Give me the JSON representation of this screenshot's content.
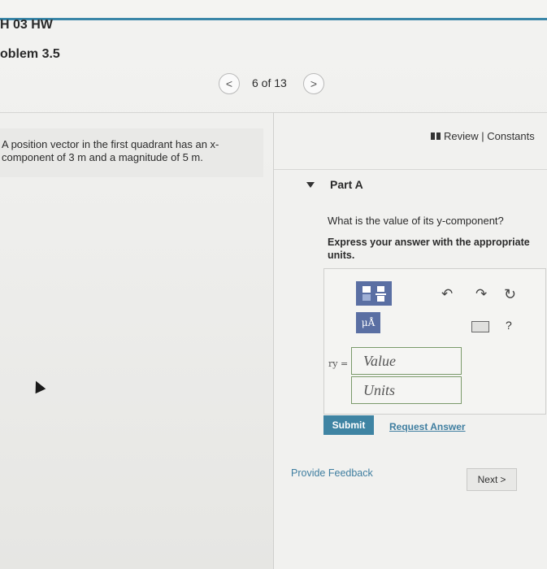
{
  "header": {
    "course": "H 03 HW",
    "problem": "oblem 3.5"
  },
  "pager": {
    "prev": "<",
    "current": "6 of 13",
    "next": ">"
  },
  "prompt": {
    "text": "A position vector in the first quadrant has an x-component of 3 m and a magnitude of 5 m."
  },
  "links": {
    "review": "Review | Constants"
  },
  "part": {
    "title": "Part A",
    "question": "What is the value of its y-component?",
    "instruction": "Express your answer with the appropriate units."
  },
  "toolbar": {
    "units_symbol": "μÅ",
    "undo": "↶",
    "redo": "↷",
    "reset": "↻",
    "help": "?"
  },
  "answer": {
    "variable": "ry =",
    "value_placeholder": "Value",
    "units_placeholder": "Units"
  },
  "actions": {
    "submit": "Submit",
    "request_answer": "Request Answer",
    "provide_feedback": "Provide Feedback",
    "next": "Next",
    "next_icon": ">"
  },
  "colors": {
    "accent": "#3f84a3",
    "link": "#3f7ea0",
    "template_btn": "#5a6fa3",
    "topbar_line": "#3a86a8"
  }
}
